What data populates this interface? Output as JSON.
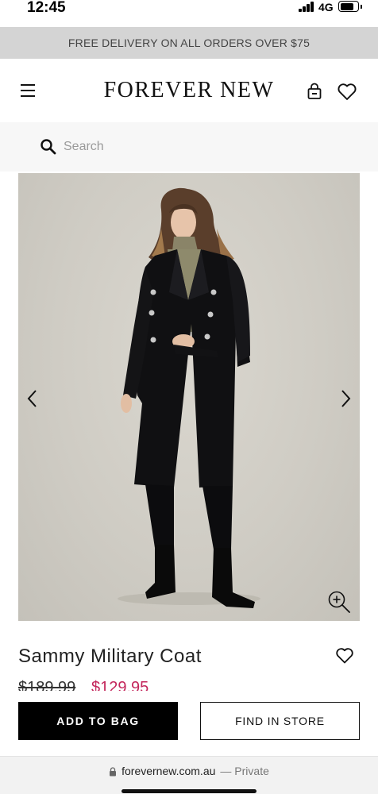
{
  "status_bar": {
    "time": "12:45",
    "network": "4G"
  },
  "promo": {
    "text": "FREE DELIVERY ON ALL ORDERS OVER $75"
  },
  "header": {
    "brand": "FOREVER NEW"
  },
  "search": {
    "placeholder": "Search",
    "value": ""
  },
  "product": {
    "name": "Sammy Military Coat",
    "price_original": "$189.99",
    "price_sale": "$129.95"
  },
  "actions": {
    "add_to_bag": "ADD TO BAG",
    "find_in_store": "FIND IN STORE"
  },
  "browser": {
    "domain": "forevernew.com.au",
    "mode": "— Private"
  },
  "colors": {
    "sale_price": "#c3265b",
    "banner": "#d4d4d4",
    "image_bg": "#cfccc4"
  },
  "icons": [
    "menu-icon",
    "bag-icon",
    "heart-icon",
    "search-icon",
    "chevron-left-icon",
    "chevron-right-icon",
    "zoom-in-icon",
    "lock-icon"
  ]
}
